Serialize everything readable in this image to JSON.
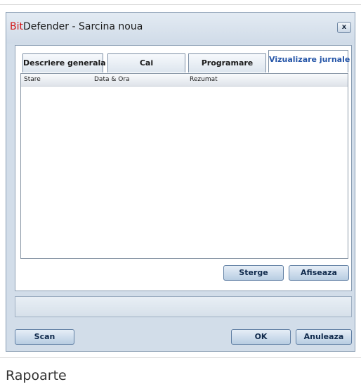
{
  "window": {
    "title_brand": "Bit",
    "title_rest": "Defender - Sarcina noua",
    "close_label": "x"
  },
  "tabs": [
    {
      "label": "Descriere generala"
    },
    {
      "label": "Cai"
    },
    {
      "label": "Programare"
    },
    {
      "label": "Vizualizare jurnale"
    }
  ],
  "log_list": {
    "columns": [
      "Stare",
      "Data & Ora",
      "Rezumat"
    ],
    "rows": []
  },
  "panel_buttons": {
    "delete_label": "Sterge",
    "show_label": "Afiseaza"
  },
  "footer_buttons": {
    "scan_label": "Scan",
    "ok_label": "OK",
    "cancel_label": "Anuleaza"
  },
  "caption": "Rapoarte"
}
